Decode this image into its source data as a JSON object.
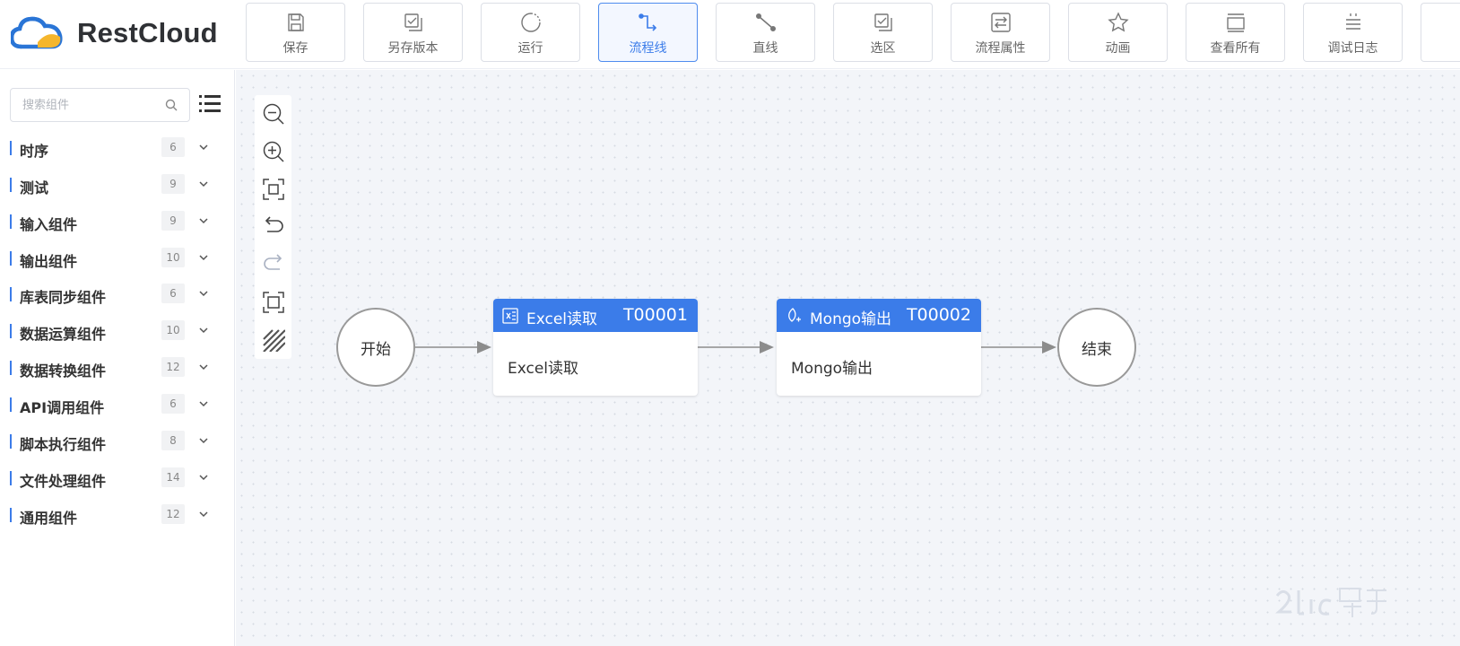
{
  "app": {
    "name": "RestCloud",
    "logo_icon": "cloud-logo-icon"
  },
  "toolbar": [
    {
      "label": "保存",
      "icon": "save-icon"
    },
    {
      "label": "另存版本",
      "icon": "save-version-icon"
    },
    {
      "label": "运行",
      "icon": "run-icon"
    },
    {
      "label": "流程线",
      "icon": "flow-line-icon",
      "active": true
    },
    {
      "label": "直线",
      "icon": "straight-line-icon"
    },
    {
      "label": "选区",
      "icon": "select-area-icon"
    },
    {
      "label": "流程属性",
      "icon": "flow-properties-icon"
    },
    {
      "label": "动画",
      "icon": "animation-icon"
    },
    {
      "label": "查看所有",
      "icon": "view-all-icon"
    },
    {
      "label": "调试日志",
      "icon": "debug-log-icon"
    }
  ],
  "sidebar": {
    "search": {
      "placeholder": "搜索组件",
      "value": ""
    },
    "categories": [
      {
        "label": "时序",
        "count": "6"
      },
      {
        "label": "测试",
        "count": "9"
      },
      {
        "label": "输入组件",
        "count": "9"
      },
      {
        "label": "输出组件",
        "count": "10"
      },
      {
        "label": "库表同步组件",
        "count": "6"
      },
      {
        "label": "数据运算组件",
        "count": "10"
      },
      {
        "label": "数据转换组件",
        "count": "12"
      },
      {
        "label": "API调用组件",
        "count": "6"
      },
      {
        "label": "脚本执行组件",
        "count": "8"
      },
      {
        "label": "文件处理组件",
        "count": "14"
      },
      {
        "label": "通用组件",
        "count": "12"
      }
    ]
  },
  "canvas_tools": [
    "zoom-out-icon",
    "zoom-in-icon",
    "fit-view-icon",
    "undo-icon",
    "redo-icon",
    "actual-size-icon",
    "grid-toggle-icon"
  ],
  "flow": {
    "start": {
      "label": "开始"
    },
    "end": {
      "label": "结束"
    },
    "tasks": [
      {
        "name": "Excel读取",
        "id": "T00001",
        "body": "Excel读取",
        "icon": "excel-icon"
      },
      {
        "name": "Mongo输出",
        "id": "T00002",
        "body": "Mongo输出",
        "icon": "mongo-icon"
      }
    ]
  },
  "colors": {
    "accent": "#3b7ce9",
    "node_border": "#999999",
    "canvas_bg": "#f3f5f9"
  }
}
